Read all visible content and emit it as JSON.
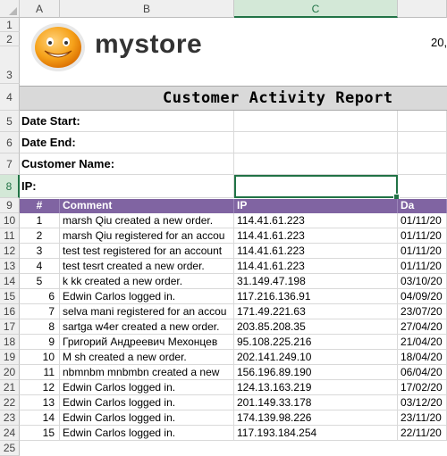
{
  "columns": [
    "A",
    "B",
    "C"
  ],
  "rows": [
    "1",
    "2",
    "3",
    "4",
    "5",
    "6",
    "7",
    "8",
    "9",
    "10",
    "11",
    "12",
    "13",
    "14",
    "15",
    "16",
    "17",
    "18",
    "19",
    "20",
    "21",
    "22",
    "23",
    "24",
    "25"
  ],
  "logo": {
    "text": "mystore"
  },
  "header_date": "20,",
  "report_title": "Customer Activity Report",
  "filters": {
    "date_start": "Date Start:",
    "date_end": "Date End:",
    "customer_name": "Customer Name:",
    "ip": "IP:"
  },
  "table": {
    "headers": {
      "num": "#",
      "comment": "Comment",
      "ip": "IP",
      "date": "Da"
    },
    "rows": [
      {
        "num": "1",
        "comment": "marsh Qiu created a new order.",
        "ip": "114.41.61.223",
        "date": "01/11/20"
      },
      {
        "num": "2",
        "comment": "marsh Qiu registered for an accou",
        "ip": "114.41.61.223",
        "date": "01/11/20"
      },
      {
        "num": "3",
        "comment": "test test registered for an account",
        "ip": "114.41.61.223",
        "date": "01/11/20"
      },
      {
        "num": "4",
        "comment": "test tesrt created a new order.",
        "ip": "114.41.61.223",
        "date": "01/11/20"
      },
      {
        "num": "5",
        "comment": "k kk created a new order.",
        "ip": "31.149.47.198",
        "date": "03/10/20"
      },
      {
        "num": "6",
        "comment": "Edwin  Carlos logged in.",
        "ip": "117.216.136.91",
        "date": "04/09/20"
      },
      {
        "num": "7",
        "comment": "selva mani registered for an accou",
        "ip": "171.49.221.63",
        "date": "23/07/20"
      },
      {
        "num": "8",
        "comment": "sartga w4er created a new order.",
        "ip": "203.85.208.35",
        "date": "27/04/20"
      },
      {
        "num": "9",
        "comment": "Григорий Андреевич Мехонцев",
        "ip": "95.108.225.216",
        "date": "21/04/20"
      },
      {
        "num": "10",
        "comment": "M sh created a new order.",
        "ip": "202.141.249.10",
        "date": "18/04/20"
      },
      {
        "num": "11",
        "comment": "nbmnbm mnbmbn created a new",
        "ip": "156.196.89.190",
        "date": "06/04/20"
      },
      {
        "num": "12",
        "comment": "Edwin  Carlos logged in.",
        "ip": "124.13.163.219",
        "date": "17/02/20"
      },
      {
        "num": "13",
        "comment": "Edwin  Carlos logged in.",
        "ip": "201.149.33.178",
        "date": "03/12/20"
      },
      {
        "num": "14",
        "comment": "Edwin  Carlos logged in.",
        "ip": "174.139.98.226",
        "date": "23/11/20"
      },
      {
        "num": "15",
        "comment": "Edwin  Carlos logged in.",
        "ip": "117.193.184.254",
        "date": "22/11/20"
      }
    ]
  },
  "colors": {
    "header_purple": "#8064a2",
    "selection_green": "#217346",
    "title_band": "#d9d9d9"
  }
}
